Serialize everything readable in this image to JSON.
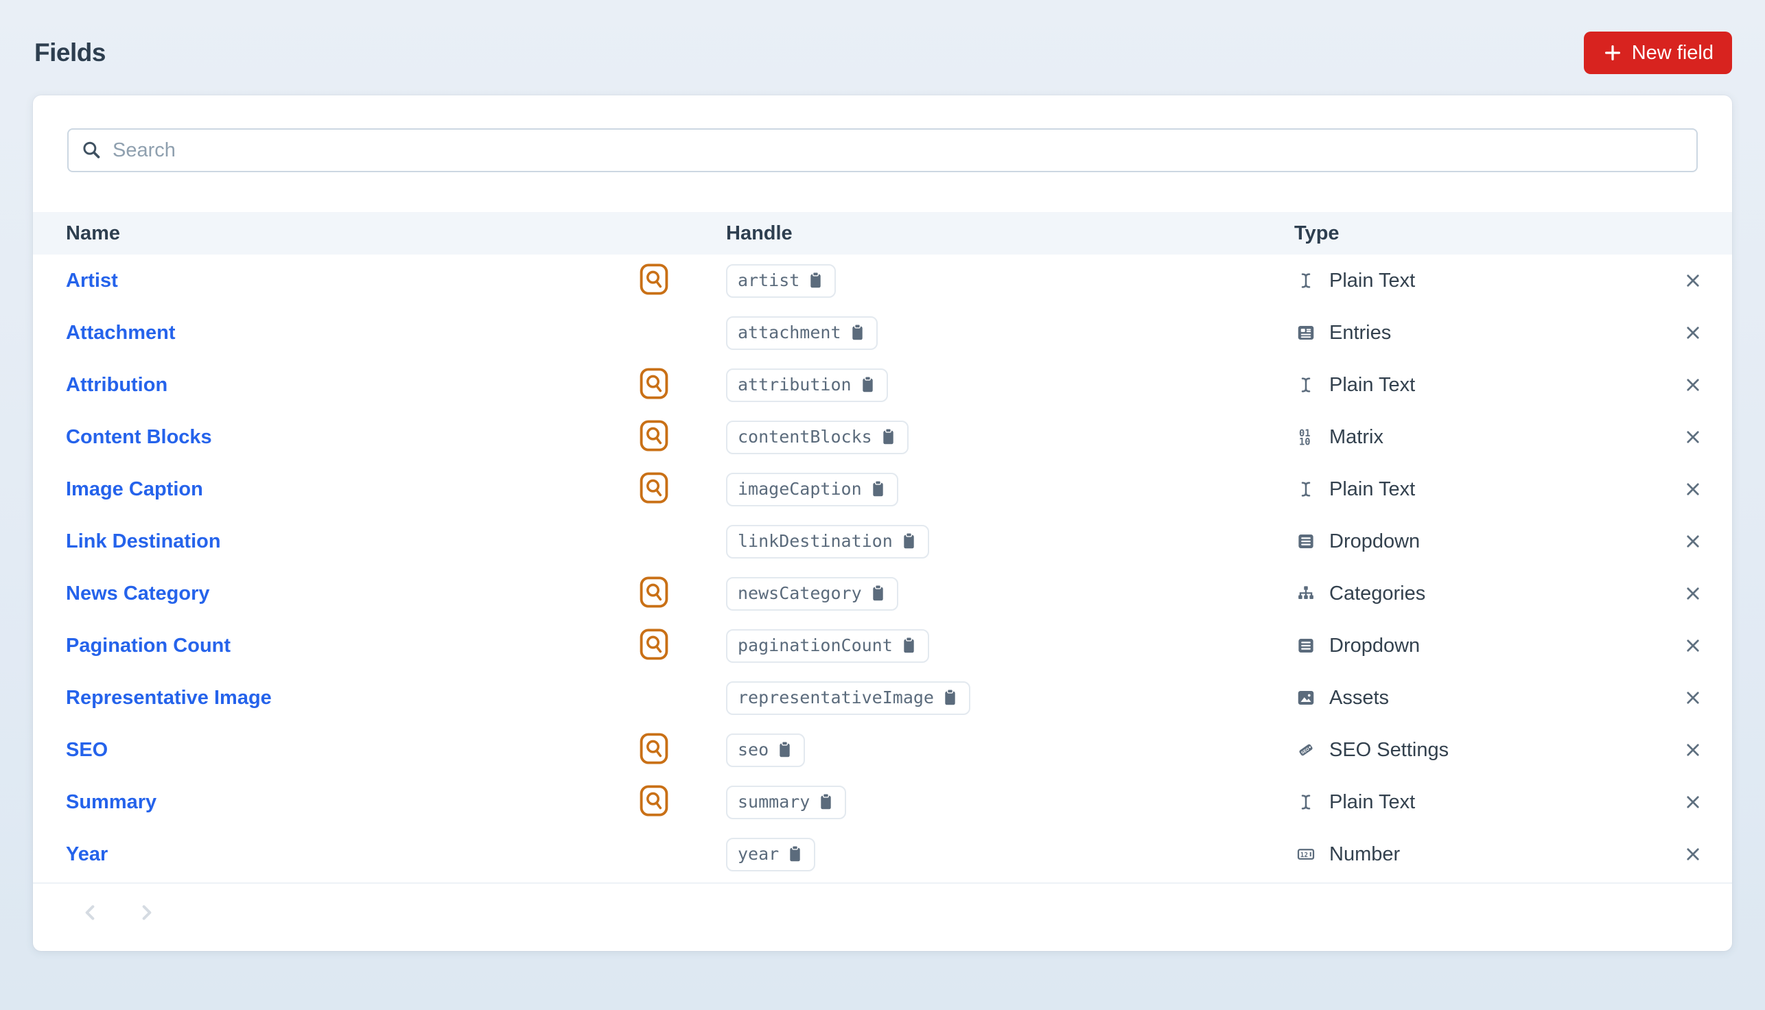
{
  "page": {
    "title": "Fields"
  },
  "toolbar": {
    "new_field_label": "New field"
  },
  "search": {
    "placeholder": "Search"
  },
  "table": {
    "headers": {
      "name": "Name",
      "handle": "Handle",
      "type": "Type"
    },
    "rows": [
      {
        "name": "Artist",
        "handle": "artist",
        "type": "Plain Text",
        "type_icon": "text-cursor-icon",
        "searchable": true
      },
      {
        "name": "Attachment",
        "handle": "attachment",
        "type": "Entries",
        "type_icon": "entries-icon",
        "searchable": false
      },
      {
        "name": "Attribution",
        "handle": "attribution",
        "type": "Plain Text",
        "type_icon": "text-cursor-icon",
        "searchable": true
      },
      {
        "name": "Content Blocks",
        "handle": "contentBlocks",
        "type": "Matrix",
        "type_icon": "matrix-icon",
        "searchable": true
      },
      {
        "name": "Image Caption",
        "handle": "imageCaption",
        "type": "Plain Text",
        "type_icon": "text-cursor-icon",
        "searchable": true
      },
      {
        "name": "Link Destination",
        "handle": "linkDestination",
        "type": "Dropdown",
        "type_icon": "dropdown-icon",
        "searchable": false
      },
      {
        "name": "News Category",
        "handle": "newsCategory",
        "type": "Categories",
        "type_icon": "categories-icon",
        "searchable": true
      },
      {
        "name": "Pagination Count",
        "handle": "paginationCount",
        "type": "Dropdown",
        "type_icon": "dropdown-icon",
        "searchable": true
      },
      {
        "name": "Representative Image",
        "handle": "representativeImage",
        "type": "Assets",
        "type_icon": "assets-icon",
        "searchable": false
      },
      {
        "name": "SEO",
        "handle": "seo",
        "type": "SEO Settings",
        "type_icon": "seo-icon",
        "searchable": true
      },
      {
        "name": "Summary",
        "handle": "summary",
        "type": "Plain Text",
        "type_icon": "text-cursor-icon",
        "searchable": true
      },
      {
        "name": "Year",
        "handle": "year",
        "type": "Number",
        "type_icon": "number-icon",
        "searchable": false
      }
    ]
  },
  "colors": {
    "accent_red": "#d8231f",
    "link_blue": "#2563eb",
    "searchable_orange": "#c97016",
    "icon_slate": "#5b6b7c"
  }
}
